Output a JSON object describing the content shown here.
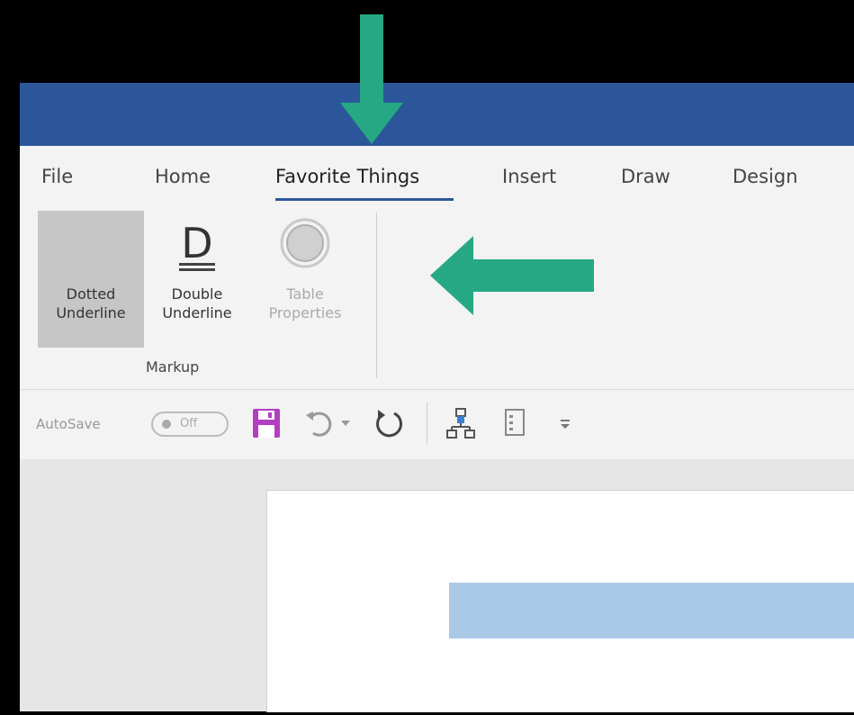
{
  "tabs": [
    "File",
    "Home",
    "Favorite Things",
    "Insert",
    "Draw",
    "Design"
  ],
  "active_tab": "Favorite Things",
  "commands": [
    {
      "label": "Dotted\nUnderline",
      "state": "pressed"
    },
    {
      "label": "Double\nUnderline",
      "state": "normal",
      "icon_letter": "D"
    },
    {
      "label": "Table\nProperties",
      "state": "disabled"
    }
  ],
  "group_label": "Markup",
  "qat": {
    "autosave_label": "AutoSave",
    "toggle_text": "Off"
  },
  "colors": {
    "title_bar": "#2b579a",
    "arrow": "#26a884",
    "selection": "#aac9e6",
    "save_icon": "#b43ec3"
  },
  "icons": [
    "save-icon",
    "undo-icon",
    "redo-icon",
    "org-chart-icon",
    "form-icon",
    "customize-qat-icon"
  ]
}
